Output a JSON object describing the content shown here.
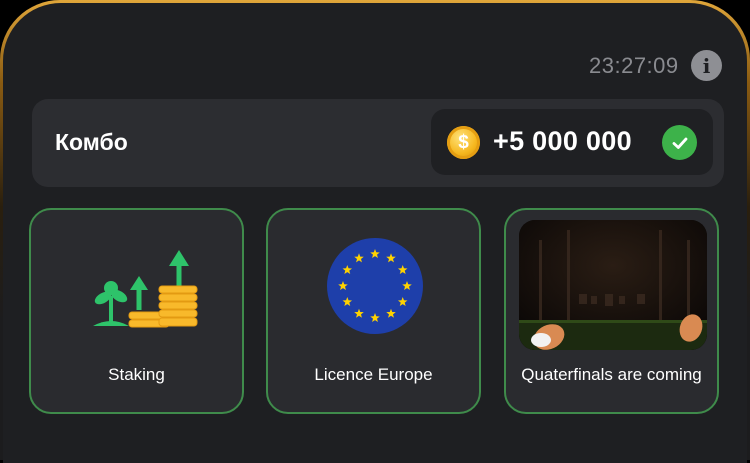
{
  "timer": "23:27:09",
  "info_icon": "i",
  "combo": {
    "title": "Комбо",
    "reward": "+5 000 000",
    "coin_symbol": "$",
    "coin_icon": "coin-icon",
    "check_icon": "check-icon"
  },
  "cards": [
    {
      "label": "Staking",
      "icon": "staking-growth-icon"
    },
    {
      "label": "Licence Europe",
      "icon": "eu-flag-icon"
    },
    {
      "label": "Quaterfinals are coming",
      "icon": "video-thumbnail"
    }
  ],
  "colors": {
    "accent_gold": "#e0a63a",
    "card_border": "#3f8b4b",
    "check_green": "#3db24a",
    "coin_gold": "#f6b71e",
    "eu_blue": "#1e3faa",
    "eu_star": "#ffd200"
  }
}
